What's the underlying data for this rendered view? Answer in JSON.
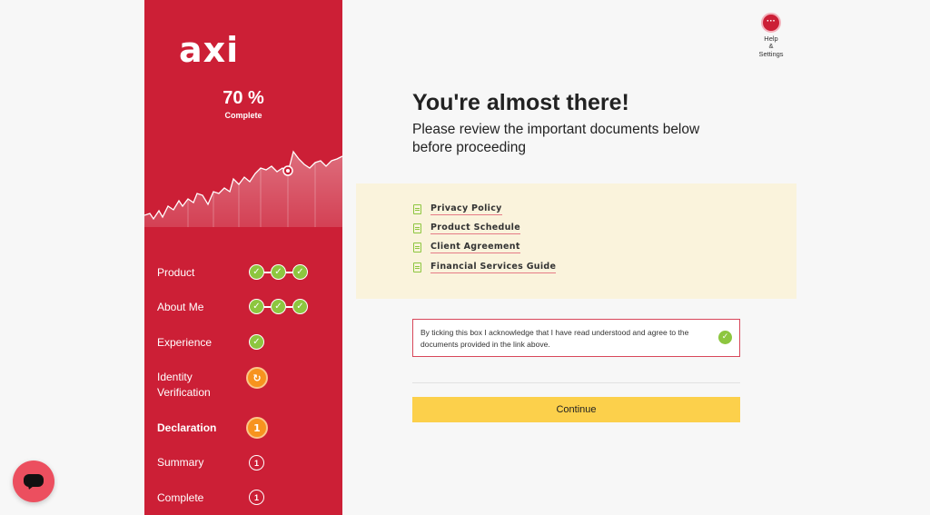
{
  "sidebar": {
    "logo": "axi",
    "progress_value": "70 %",
    "progress_label": "Complete",
    "steps": [
      {
        "label": "Product",
        "status": "done",
        "checks": 3
      },
      {
        "label": "About Me",
        "status": "done",
        "checks": 3
      },
      {
        "label": "Experience",
        "status": "done",
        "checks": 1
      },
      {
        "label": "Identity Verification",
        "status": "in-progress",
        "icon": "refresh-icon"
      },
      {
        "label": "Declaration",
        "status": "current",
        "badge": "1"
      },
      {
        "label": "Summary",
        "status": "pending",
        "badge": "1"
      },
      {
        "label": "Complete",
        "status": "pending",
        "badge": "1"
      }
    ],
    "check_glyph": "✓",
    "refresh_glyph": "↻"
  },
  "help": {
    "button_glyph": "···",
    "label": "Help & Settings"
  },
  "main": {
    "title": "You're almost there!",
    "subtitle": "Please review the important documents below before proceeding",
    "documents": [
      "Privacy Policy",
      "Product Schedule",
      "Client Agreement",
      "Financial Services Guide"
    ],
    "acknowledgement": "By ticking this box I acknowledge that I have read understood and agree to the documents provided in the link above.",
    "acknowledgement_checked": true,
    "continue_label": "Continue"
  },
  "colors": {
    "brand_red": "#cc1f36",
    "check_green": "#8dc63f",
    "step_orange": "#f7931e",
    "button_yellow": "#fcd04b"
  }
}
